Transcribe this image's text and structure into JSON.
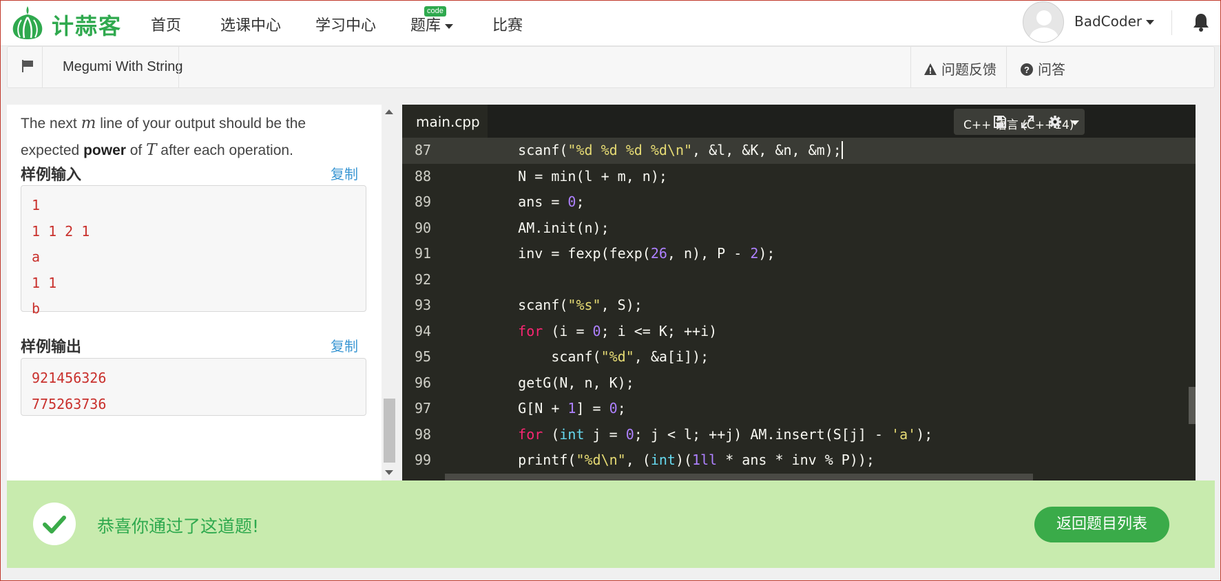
{
  "nav": {
    "logo_text": "计蒜客",
    "items": [
      "首页",
      "选课中心",
      "学习中心",
      "题库",
      "比赛"
    ],
    "code_badge": "code",
    "username": "BadCoder"
  },
  "subbar": {
    "problem_title": "Megumi With String",
    "feedback_label": "问题反馈",
    "qa_label": "问答"
  },
  "problem": {
    "desc_part1": "The next ",
    "desc_math_m": "m",
    "desc_part2": " line of your output should be the expected ",
    "desc_bold": "power",
    "desc_part3": " of ",
    "desc_math_t": "T",
    "desc_part4": " after each operation.",
    "sample_input_title": "样例输入",
    "sample_output_title": "样例输出",
    "copy_label": "复制",
    "sample_input_lines": [
      "1",
      "1 1 2 1",
      "a",
      "1 1",
      "b"
    ],
    "sample_output_lines": [
      "921456326",
      "775263736"
    ]
  },
  "editor": {
    "tab_label": "main.cpp",
    "language": "C++ 语言 (C++14)",
    "line_numbers": [
      "87",
      "88",
      "89",
      "90",
      "91",
      "92",
      "93",
      "94",
      "95",
      "96",
      "97",
      "98",
      "99"
    ]
  },
  "banner": {
    "message": "恭喜你通过了这道题!",
    "back_button": "返回题目列表"
  },
  "colors": {
    "brand_green": "#2fa94e",
    "editor_bg": "#272822",
    "banner_bg": "#c8ebae",
    "sample_red": "#c9302c",
    "link_blue": "#3b97d3"
  }
}
